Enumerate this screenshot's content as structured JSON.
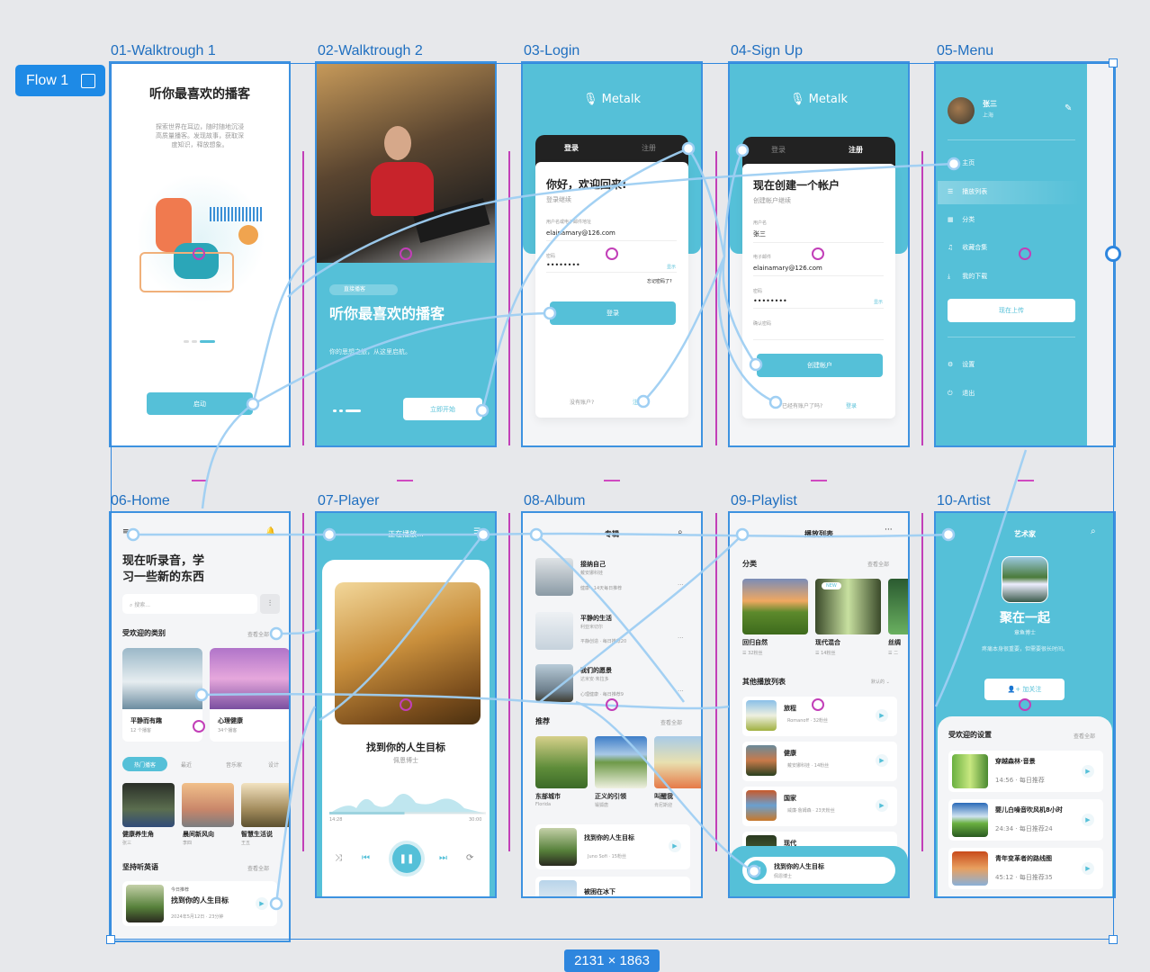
{
  "flow": {
    "label": "Flow 1",
    "dimensions": "2131 × 1863"
  },
  "colors": {
    "accent": "#55c0d8",
    "selection": "#2e86de",
    "flow_button": "#1e8ae6",
    "hotspot": "#c23fb8",
    "connector": "#9fcff3"
  },
  "frames": {
    "f01": {
      "name": "01-Walktrough 1",
      "title": "听你最喜欢的播客",
      "desc1": "探索世界在耳边，随时随地沉浸",
      "desc2": "高质量播客。发现故事，获取深",
      "desc3": "度知识，释放想象。",
      "button": "启动"
    },
    "f02": {
      "name": "02-Walktrough 2",
      "badge": "直接播客",
      "title": "听你最喜欢的播客",
      "desc": "你的思想之旅，从这里启航。",
      "button": "立即开始"
    },
    "f03": {
      "name": "03-Login",
      "logo": "Metalk",
      "tab_login": "登录",
      "tab_signup": "注册",
      "title": "你好，欢迎回来!",
      "subtitle": "登录继续",
      "email_label": "用户名或电子邮件地址",
      "email_value": "elainamary@126.com",
      "password_label": "密码",
      "password_value": "••••••••",
      "show": "显示",
      "forgot": "忘记密码了?",
      "button": "登录",
      "no_account": "没有账户?",
      "signup_link": "注册"
    },
    "f04": {
      "name": "04-Sign Up",
      "logo": "Metalk",
      "tab_login": "登录",
      "tab_signup": "注册",
      "title": "现在创建一个帐户",
      "subtitle": "创建帐户继续",
      "username_label": "用户名",
      "username_value": "张三",
      "email_label": "电子邮件",
      "email_value": "elainamary@126.com",
      "password_label": "密码",
      "password_value": "••••••••",
      "show": "显示",
      "confirm_label": "确认密码",
      "button": "创建帐户",
      "have_account": "已经有账户了吗?",
      "login_link": "登录"
    },
    "f05": {
      "name": "05-Menu",
      "user": "张三",
      "location": "上海",
      "items": [
        {
          "label": "主页",
          "icon": "home-icon"
        },
        {
          "label": "播放列表",
          "icon": "playlist-icon"
        },
        {
          "label": "分类",
          "icon": "grid-icon"
        },
        {
          "label": "收藏合集",
          "icon": "collection-icon"
        },
        {
          "label": "我的下载",
          "icon": "download-icon"
        }
      ],
      "upload": "现在上传",
      "settings": "设置",
      "logout": "退出"
    },
    "f06": {
      "name": "06-Home",
      "title1": "现在听录音，学",
      "title2": "习一些新的东西",
      "search_placeholder": "搜索...",
      "popular": "受欢迎的类别",
      "see_all": "查看全部",
      "categories": [
        {
          "title": "平静而有趣",
          "count": "12 个播客"
        },
        {
          "title": "心理健康",
          "count": "34个播客"
        }
      ],
      "tabs": [
        "热门播客",
        "最近",
        "音乐家",
        "设计"
      ],
      "podcasts": [
        {
          "title": "健康养生角",
          "author": "张三"
        },
        {
          "title": "晨间新风向",
          "author": "李四"
        },
        {
          "title": "智慧生活说",
          "author": "王五"
        }
      ],
      "english": "坚持听英语",
      "english_see_all": "查看全部",
      "today_label": "今日推荐",
      "today_title": "找到你的人生目标",
      "today_meta": "2024年5月12日 · 23分钟"
    },
    "f07": {
      "name": "07-Player",
      "header": "正在播放...",
      "title": "找到你的人生目标",
      "author": "佩恩博士",
      "current": "14:28",
      "total": "30:00",
      "progress": 0.48
    },
    "f08": {
      "name": "08-Album",
      "header": "专辑",
      "albums": [
        {
          "title": "接纳自己",
          "author": "戴安娜科娃",
          "meta": "健康 · 14天每日推荐"
        },
        {
          "title": "平静的生活",
          "author": "利亚米切尔",
          "meta": "平静创造 · 每日推荐20"
        },
        {
          "title": "我们的愿景",
          "author": "达米安·朱拉多",
          "meta": "心理健康 · 每日推荐9"
        }
      ],
      "recommend": "推荐",
      "see_all": "查看全部",
      "recs": [
        {
          "title": "东部城市",
          "sub": "Florida"
        },
        {
          "title": "正义的引领",
          "sub": "锻狐唐"
        },
        {
          "title": "叫醒我",
          "sub": "肯尼斯迎"
        }
      ],
      "tracks": [
        {
          "title": "找到你的人生目标",
          "meta": "Juno Sofi · 15粉丝"
        },
        {
          "title": "被困在冰下"
        }
      ]
    },
    "f09": {
      "name": "09-Playlist",
      "header": "播放列表",
      "category": "分类",
      "see_all": "查看全部",
      "cats": [
        {
          "title": "回归自然",
          "meta": "32粉丝"
        },
        {
          "title": "现代混合",
          "meta": "14粉丝",
          "badge": "NEW"
        },
        {
          "title": "丝绸",
          "meta": "二"
        }
      ],
      "others": "其他播放列表",
      "sort": "默认的",
      "lists": [
        {
          "title": "旅程",
          "meta": "Romanoff · 32粉丝"
        },
        {
          "title": "健康",
          "meta": "戴安娜科娃 · 14粉丝"
        },
        {
          "title": "国家",
          "meta": "威廉·詹姆森 · 23天粉丝"
        },
        {
          "title": "现代"
        }
      ],
      "now_title": "找到你的人生目标",
      "now_author": "佩恩博士"
    },
    "f10": {
      "name": "10-Artist",
      "header": "艺术家",
      "title": "聚在一起",
      "author": "章鱼博士",
      "quote": "疼痛本身很重要，但需要很长时间。",
      "follow": "加关注",
      "popular": "受欢迎的设置",
      "see_all": "查看全部",
      "tracks": [
        {
          "title": "穿越森林·音景",
          "meta": "14:56 · 每日推荐"
        },
        {
          "title": "婴儿白噪音吹风机8小时",
          "meta": "24:34 · 每日推荐24"
        },
        {
          "title": "青年变革者的路线图",
          "meta": "45:12 · 每日推荐35"
        }
      ]
    }
  }
}
